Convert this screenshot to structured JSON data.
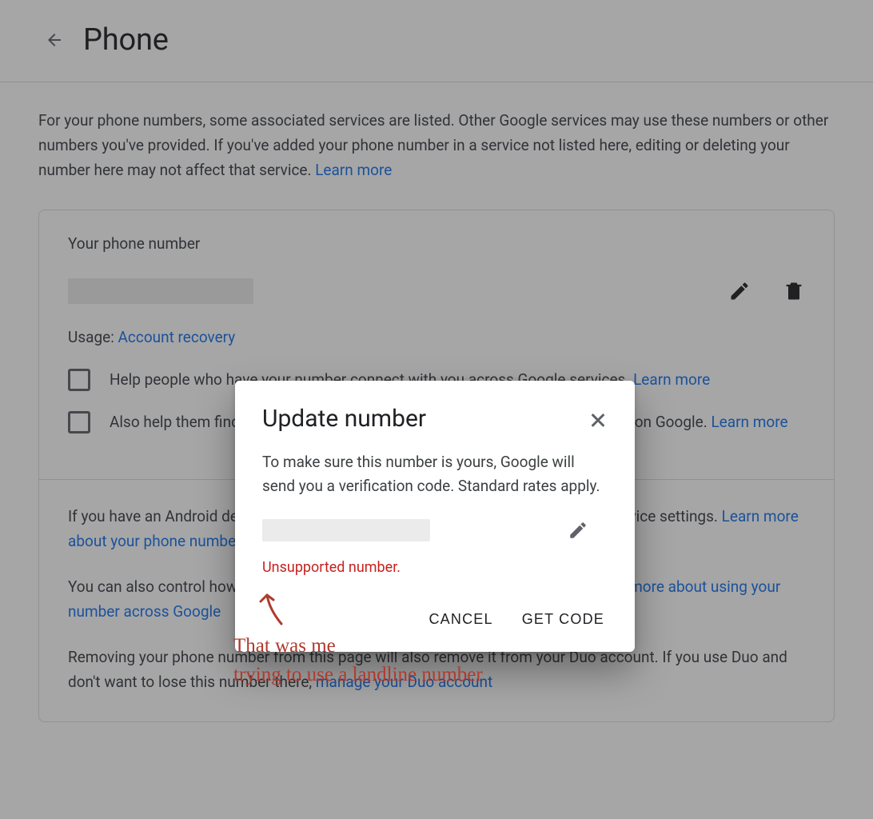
{
  "header": {
    "title": "Phone"
  },
  "intro": {
    "text": "For your phone numbers, some associated services are listed. Other Google services may use these numbers or other numbers you've provided. If you've added your phone number in a service not listed here, editing or deleting your number here may not affect that service. ",
    "learn_more": "Learn more"
  },
  "panel": {
    "heading": "Your phone number",
    "usage_label": "Usage: ",
    "usage_link": "Account recovery",
    "option1": {
      "pre": "Help people who have your number connect with you across Google services. ",
      "link": "Learn more"
    },
    "option2": {
      "pre": "Also help them find you and connect with you in ads that may be made visible on Google. ",
      "link": "Learn more"
    },
    "para1": {
      "pre": "If you have an Android device, you can find and update the phone number in your device settings. ",
      "link": "Learn more about your phone number and Android devices"
    },
    "para2": {
      "pre": "You can also control how your phone number helps people connect with you. ",
      "link": "Learn more about using your number across Google"
    },
    "para3": {
      "pre": "Removing your phone number from this page will also remove it from your Duo account. If you use Duo and don't want to lose this number there, ",
      "link": "manage your Duo account"
    }
  },
  "modal": {
    "title": "Update number",
    "body": "To make sure this number is yours, Google will send you a verification code. Standard rates apply.",
    "error": "Unsupported number.",
    "cancel": "CANCEL",
    "get_code": "GET CODE"
  },
  "annotation": {
    "text": "That was me\ntrying to use a landline number"
  }
}
